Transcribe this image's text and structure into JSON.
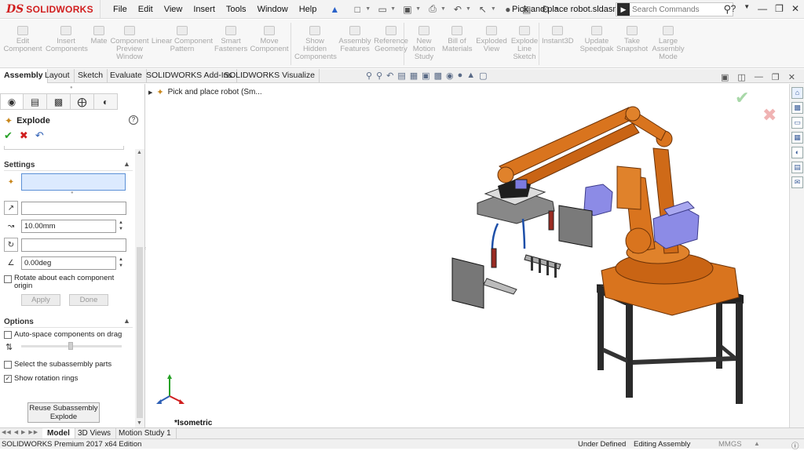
{
  "app": {
    "brand_ds": "DS",
    "brand_name": "SOLIDWORKS"
  },
  "menu": [
    "File",
    "Edit",
    "View",
    "Insert",
    "Tools",
    "Window",
    "Help"
  ],
  "document_title": "Pick and place robot.sldasm *",
  "search": {
    "placeholder": "Search Commands"
  },
  "ribbon": [
    {
      "label": "Edit Component",
      "lines": [
        "Edit",
        "Component"
      ]
    },
    {
      "label": "Insert Components",
      "lines": [
        "Insert",
        "Components"
      ]
    },
    {
      "label": "Mate",
      "lines": [
        "Mate"
      ]
    },
    {
      "label": "Component Preview Window",
      "lines": [
        "Component",
        "Preview",
        "Window"
      ]
    },
    {
      "label": "Linear Component Pattern",
      "lines": [
        "Linear Component",
        "Pattern"
      ]
    },
    {
      "label": "Smart Fasteners",
      "lines": [
        "Smart",
        "Fasteners"
      ]
    },
    {
      "label": "Move Component",
      "lines": [
        "Move",
        "Component"
      ]
    },
    {
      "label": "Show Hidden Components",
      "lines": [
        "Show",
        "Hidden",
        "Components"
      ]
    },
    {
      "label": "Assembly Features",
      "lines": [
        "Assembly",
        "Features"
      ]
    },
    {
      "label": "Reference Geometry",
      "lines": [
        "Reference",
        "Geometry"
      ]
    },
    {
      "label": "New Motion Study",
      "lines": [
        "New",
        "Motion",
        "Study"
      ]
    },
    {
      "label": "Bill of Materials",
      "lines": [
        "Bill of",
        "Materials"
      ]
    },
    {
      "label": "Exploded View",
      "lines": [
        "Exploded",
        "View"
      ]
    },
    {
      "label": "Explode Line Sketch",
      "lines": [
        "Explode",
        "Line",
        "Sketch"
      ]
    },
    {
      "label": "Instant3D",
      "lines": [
        "Instant3D"
      ]
    },
    {
      "label": "Update Speedpak",
      "lines": [
        "Update",
        "Speedpak"
      ]
    },
    {
      "label": "Take Snapshot",
      "lines": [
        "Take",
        "Snapshot"
      ]
    },
    {
      "label": "Large Assembly Mode",
      "lines": [
        "Large",
        "Assembly",
        "Mode"
      ]
    }
  ],
  "command_tabs": [
    "Assembly",
    "Layout",
    "Sketch",
    "Evaluate",
    "SOLIDWORKS Add-Ins",
    "SOLIDWORKS Visualize"
  ],
  "property_manager": {
    "title": "Explode",
    "settings": {
      "header": "Settings",
      "distance_value": "10.00mm",
      "angle_value": "0.00deg",
      "rotate_each_label": "Rotate about each component origin",
      "apply_label": "Apply",
      "done_label": "Done"
    },
    "options": {
      "header": "Options",
      "auto_space_label": "Auto-space components on drag",
      "select_subassembly_label": "Select the subassembly parts",
      "show_rotation_rings_label": "Show rotation rings",
      "show_rotation_rings_checked": true,
      "reuse_button_line1": "Reuse Subassembly",
      "reuse_button_line2": "Explode"
    }
  },
  "feature_tree": {
    "root_label": "Pick and place robot  (Sm..."
  },
  "view": {
    "orientation": "*Isometric"
  },
  "bottom_tabs": [
    "Model",
    "3D Views",
    "Motion Study 1"
  ],
  "status": {
    "product": "SOLIDWORKS Premium 2017 x64 Edition",
    "state": "Under Defined",
    "mode": "Editing Assembly",
    "units": "MMGS"
  },
  "colors": {
    "accent_red": "#d11e1e",
    "robot_orange": "#d9741e",
    "motor_blue": "#8c8be6",
    "frame_black": "#2a2a2a"
  }
}
